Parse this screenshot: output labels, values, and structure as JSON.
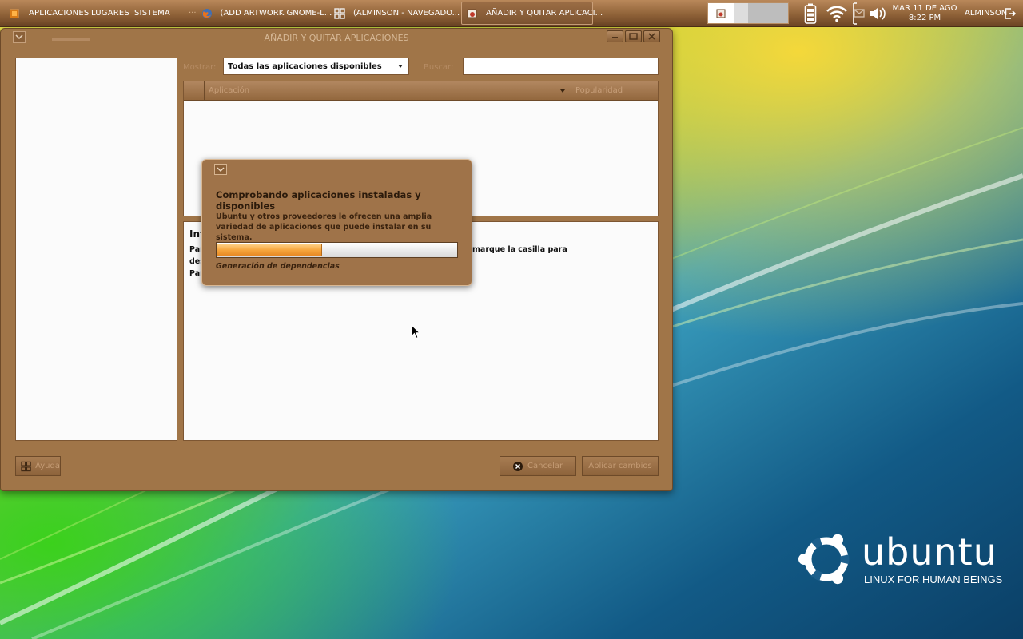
{
  "top_panel": {
    "menus": [
      "APLICACIONES",
      "LUGARES",
      "SISTEMA"
    ],
    "tasks": [
      {
        "label": "(ADD ARTWORK GNOME-L...",
        "icon": "firefox-icon"
      },
      {
        "label": "(ALMINSON - NAVEGADO...",
        "icon": "file-browser-icon"
      },
      {
        "label": "AÑADIR Y QUITAR APLICACI...",
        "icon": "add-remove-icon",
        "active": true
      }
    ],
    "clock": {
      "date": "MAR 11 DE AGO",
      "time": "8:22 PM"
    },
    "user": "ALMINSON",
    "tray_icons": [
      "battery-icon",
      "wifi-icon",
      "mail-icon",
      "volume-icon",
      "logout-icon"
    ]
  },
  "main_window": {
    "title": "AÑADIR Y QUITAR APLICACIONES",
    "show_label": "Mostrar:",
    "show_value": "Todas las aplicaciones disponibles",
    "search_label": "Buscar:",
    "search_value": "",
    "columns": [
      "Aplicación",
      "Popularidad"
    ],
    "info_title": "Int",
    "info_lines": [
      "Par                                                                       o de la misma. Desmarque la casilla para",
      "des",
      "Par                                                                       s."
    ],
    "help_button": "Ayuda",
    "cancel_button": "Cancelar",
    "apply_button": "Aplicar cambios"
  },
  "progress_dialog": {
    "title": "Comprobando aplicaciones instaladas y disponibles",
    "description": "Ubuntu y otros proveedores le ofrecen una amplia variedad de aplicaciones que puede instalar en su sistema.",
    "progress_fraction": 0.44,
    "status": "Generación de dependencias"
  },
  "desktop": {
    "logo_word": "ubuntu",
    "logo_tagline": "LINUX FOR HUMAN BEINGS"
  },
  "colors": {
    "panel": "#8f6238",
    "window": "#a07548",
    "progress": "#f6a63e"
  }
}
